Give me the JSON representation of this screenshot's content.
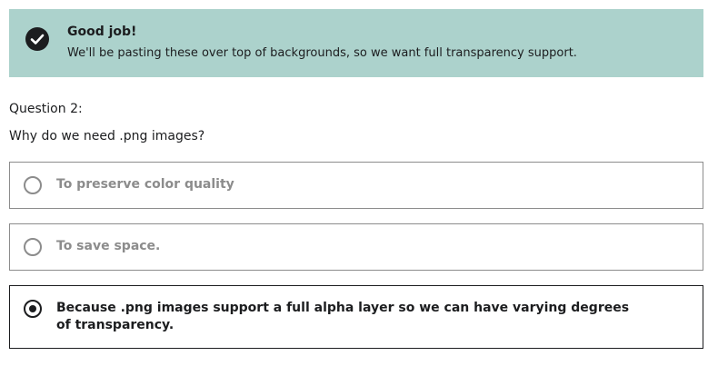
{
  "feedback": {
    "icon": "check-circle-icon",
    "title": "Good job!",
    "message": "We'll be pasting these over top of backgrounds, so we want full transparency support.",
    "background_color": "#acd2cc"
  },
  "question": {
    "label": "Question 2:",
    "prompt": "Why do we need .png images?",
    "answers": [
      {
        "text": "To preserve color quality",
        "selected": false
      },
      {
        "text": "To save space.",
        "selected": false
      },
      {
        "text": "Because .png images support a full alpha layer so we can have varying degrees of transparency.",
        "selected": true
      }
    ]
  }
}
